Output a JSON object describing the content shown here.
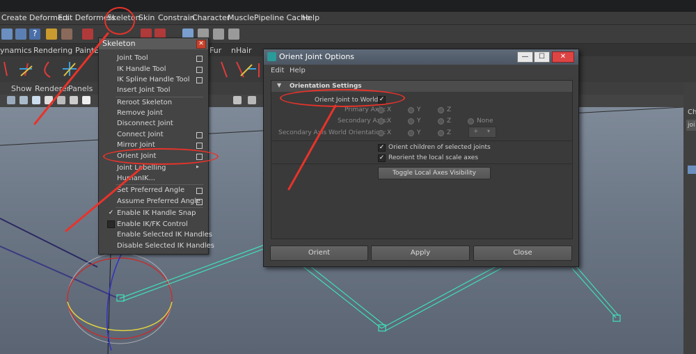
{
  "main_menu": [
    "Create Deformers",
    "Edit Deformers",
    "Skeleton",
    "Skin",
    "Constrain",
    "Character",
    "Muscle",
    "Pipeline Cache",
    "Help"
  ],
  "shelf_tabs": [
    "ynamics",
    "Rendering",
    "PaintEff",
    "Fur",
    "nHair"
  ],
  "panel_menu": [
    "Show",
    "Renderer",
    "Panels"
  ],
  "skeleton_menu": {
    "title": "Skeleton",
    "items": [
      {
        "label": "Joint Tool",
        "option_box": true
      },
      {
        "label": "IK Handle Tool",
        "option_box": true
      },
      {
        "label": "IK Spline Handle Tool",
        "option_box": true
      },
      {
        "label": "Insert Joint Tool",
        "option_box": false
      },
      {
        "label": "Reroot Skeleton",
        "option_box": false
      },
      {
        "label": "Remove Joint",
        "option_box": false
      },
      {
        "label": "Disconnect Joint",
        "option_box": false
      },
      {
        "label": "Connect Joint",
        "option_box": true
      },
      {
        "label": "Mirror Joint",
        "option_box": true
      },
      {
        "label": "Orient Joint",
        "option_box": true
      },
      {
        "label": "Joint Labelling",
        "submenu": true
      },
      {
        "label": "HumanIK...",
        "option_box": false
      },
      {
        "label": "Set Preferred Angle",
        "option_box": true
      },
      {
        "label": "Assume Preferred Angle",
        "option_box": true
      },
      {
        "label": "Enable IK Handle Snap",
        "checked": true
      },
      {
        "label": "Enable IK/FK Control",
        "checked": false
      },
      {
        "label": "Enable Selected IK Handles",
        "option_box": false
      },
      {
        "label": "Disable Selected IK Handles",
        "option_box": false
      }
    ]
  },
  "dialog": {
    "title": "Orient Joint Options",
    "menu": [
      "Edit",
      "Help"
    ],
    "section": "Orientation Settings",
    "orient_world_label": "Orient Joint to World:",
    "primary_axis_label": "Primary Axis:",
    "secondary_axis_label": "Secondary Axis:",
    "secondary_world_label": "Secondary Axis World Orientation:",
    "axis_x": "X",
    "axis_y": "Y",
    "axis_z": "Z",
    "axis_none": "None",
    "world_orient_select": "+",
    "orient_children_label": "Orient children of selected joints",
    "reorient_label": "Reorient the local scale axes",
    "toggle_button": "Toggle Local Axes Visibility",
    "buttons": [
      "Orient",
      "Apply",
      "Close"
    ]
  },
  "right_panel": {
    "tab": "Ch",
    "row": "joi"
  },
  "colors": {
    "annotation": "#e8332a",
    "joint": "#3fe0b8"
  }
}
